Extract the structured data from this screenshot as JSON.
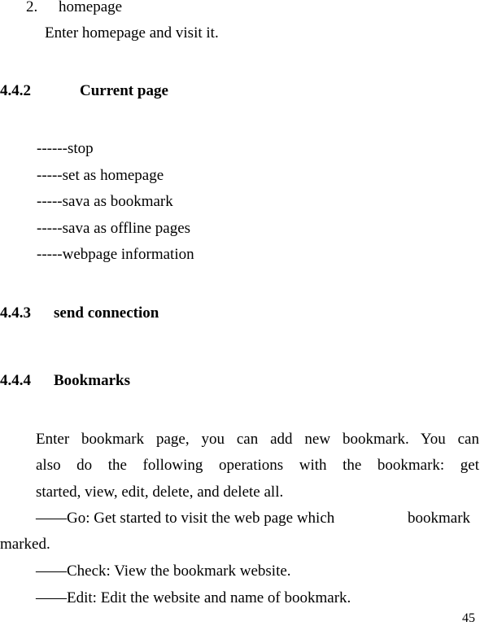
{
  "list_item": {
    "number": "2.",
    "label": "homepage",
    "description": "Enter homepage and visit it."
  },
  "section_442": {
    "number": "4.4.2",
    "title": "Current page",
    "items": [
      "------stop",
      "-----set as homepage",
      "-----sava as bookmark",
      "-----sava as offline pages",
      "-----webpage information"
    ]
  },
  "section_443": {
    "number": "4.4.3",
    "title": "send connection"
  },
  "section_444": {
    "number": "4.4.4",
    "title": "Bookmarks",
    "paragraph_lines": [
      "Enter bookmark page, you can add new bookmark. You can",
      "also do the following operations with the bookmark: get",
      "started, view, edit, delete, and delete all."
    ],
    "go_line": "——Go: Get started to visit the web page which",
    "go_line_end": "bookmark",
    "go_wrap": "marked.",
    "check_line": "——Check: View the bookmark website.",
    "edit_line": "——Edit: Edit the website and name of bookmark."
  },
  "page_number": "45"
}
